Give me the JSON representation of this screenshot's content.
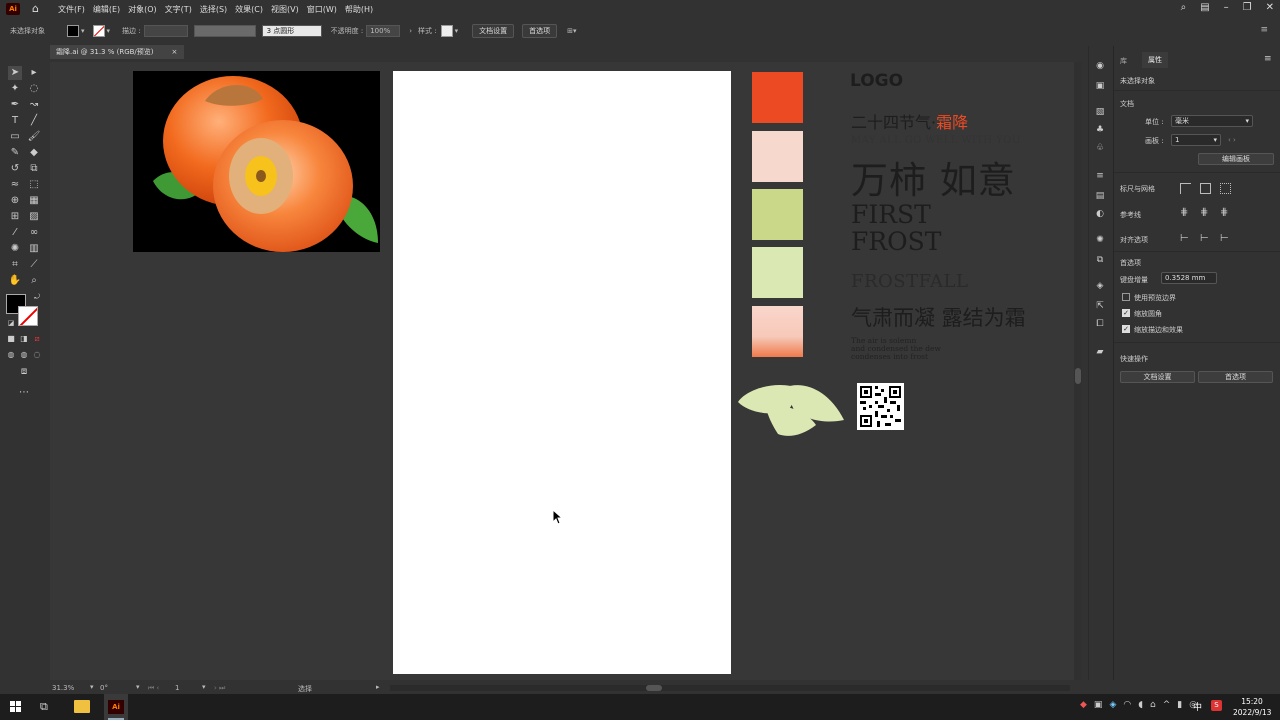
{
  "app": {
    "logo": "Ai"
  },
  "menu": [
    "文件(F)",
    "编辑(E)",
    "对象(O)",
    "文字(T)",
    "选择(S)",
    "效果(C)",
    "视图(V)",
    "窗口(W)",
    "帮助(H)"
  ],
  "control_bar": {
    "selection": "未选择对象",
    "stroke_label": "描边 :",
    "brush": "3 点圆形",
    "opacity_label": "不透明度 :",
    "opacity_value": "100%",
    "style_label": "样式 :",
    "doc_setup": "文档设置",
    "preferences": "首选项"
  },
  "tab": {
    "title": "霜降.ai @ 31.3 % (RGB/预览)",
    "close": "×"
  },
  "artwork": {
    "logo": "LOGO",
    "title_main": "二十四节气·",
    "title_accent": "霜降",
    "subtitle": "MAY ALL GO WELL WITH YOU",
    "slogan": "万柿 如意",
    "first_frost_1": "FIRST",
    "first_frost_2": "FROST",
    "frostfall": "FROSTFALL",
    "poem": "气肃而凝  露结为霜",
    "desc": [
      "The air is solemn",
      "and condensed the dew",
      "condenses into frost"
    ],
    "swatch_colors": [
      "#ec4a23",
      "#f6d8cc",
      "#c9d889",
      "#dae9b3",
      "#f7c9b9"
    ],
    "accent_color": "#ec4a23"
  },
  "properties": {
    "tab_library": "库",
    "tab_properties": "属性",
    "no_selection": "未选择对象",
    "document": "文档",
    "unit_label": "单位 :",
    "unit_value": "毫米",
    "artboard_label": "画板 :",
    "artboard_value": "1",
    "edit_artboard": "编辑画板",
    "rulers_grids": "标尺与网格",
    "guides": "参考线",
    "align_options": "对齐选项",
    "preferences": "首选项",
    "keyboard_increment": "键盘增量",
    "keyboard_increment_value": "0.3528 mm",
    "use_preview_bounds": "使用预览边界",
    "scale_corners": "缩放圆角",
    "scale_strokes": "缩放描边和效果",
    "quick_actions": "快速操作",
    "doc_setup_btn": "文档设置",
    "pref_btn": "首选项"
  },
  "status": {
    "zoom": "31.3%",
    "rotation": "0°",
    "artboard": "1",
    "mode": "选择"
  },
  "taskbar": {
    "ime": "中",
    "time": "15:20",
    "date": "2022/9/13"
  }
}
